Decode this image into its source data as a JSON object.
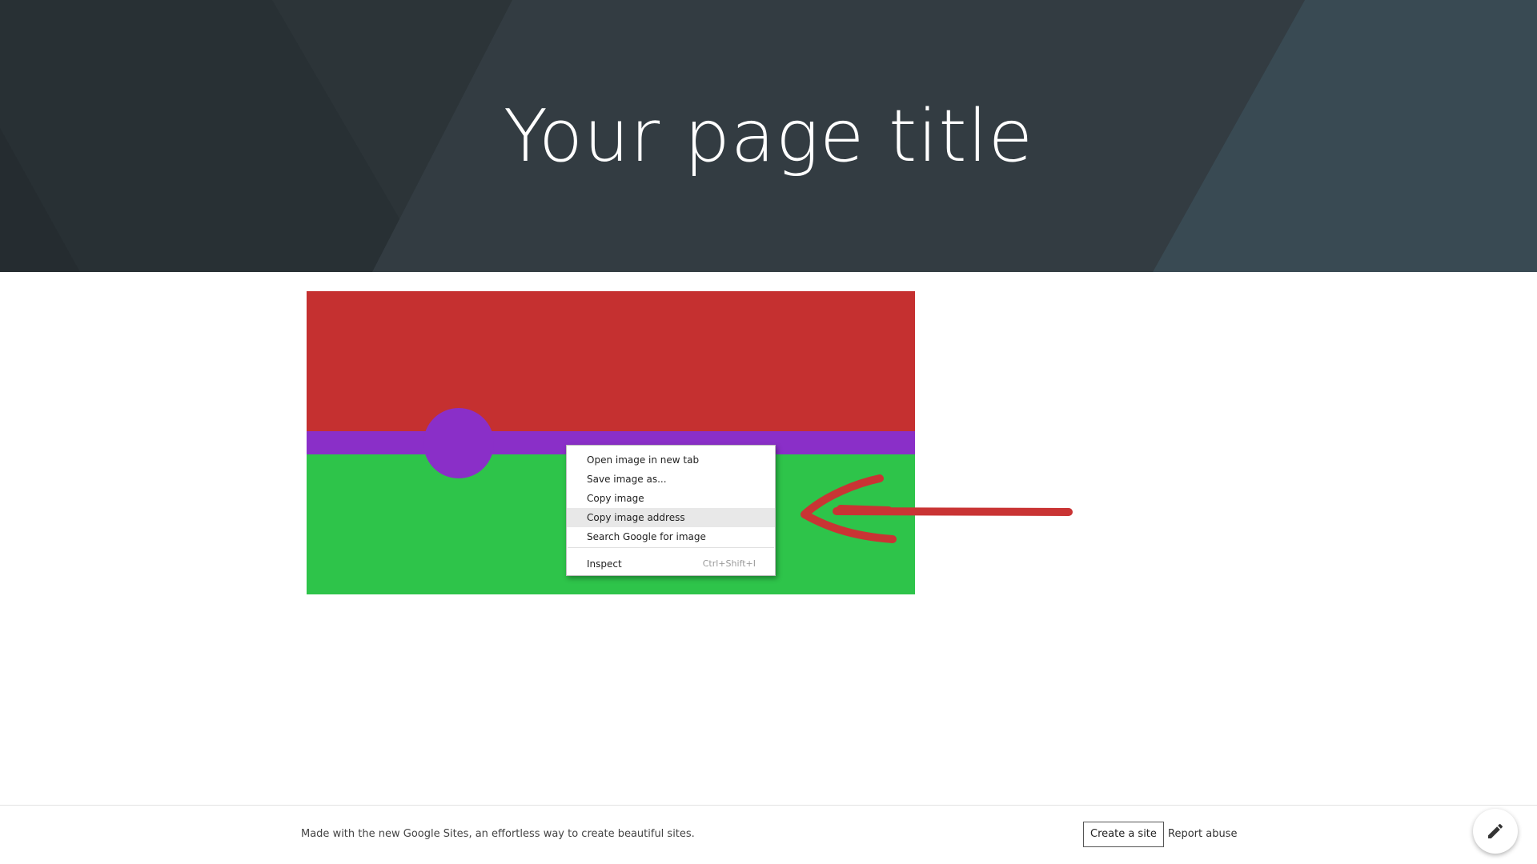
{
  "header": {
    "title": "Your page title"
  },
  "image": {
    "colors": {
      "red": "#c53030",
      "purple": "#8a2fc8",
      "green": "#2ec44a"
    }
  },
  "context_menu": {
    "items": [
      {
        "label": "Open image in new tab"
      },
      {
        "label": "Save image as..."
      },
      {
        "label": "Copy image"
      },
      {
        "label": "Copy image address",
        "highlighted": true
      },
      {
        "label": "Search Google for image"
      }
    ],
    "inspect": {
      "label": "Inspect",
      "shortcut": "Ctrl+Shift+I"
    }
  },
  "annotation": {
    "color": "#c93434",
    "icon": "hand-drawn-arrow-left"
  },
  "footer": {
    "text": "Made with the new Google Sites, an effortless way to create beautiful sites.",
    "create_site": "Create a site",
    "report_abuse": "Report abuse",
    "edit_icon": "pencil-icon"
  }
}
